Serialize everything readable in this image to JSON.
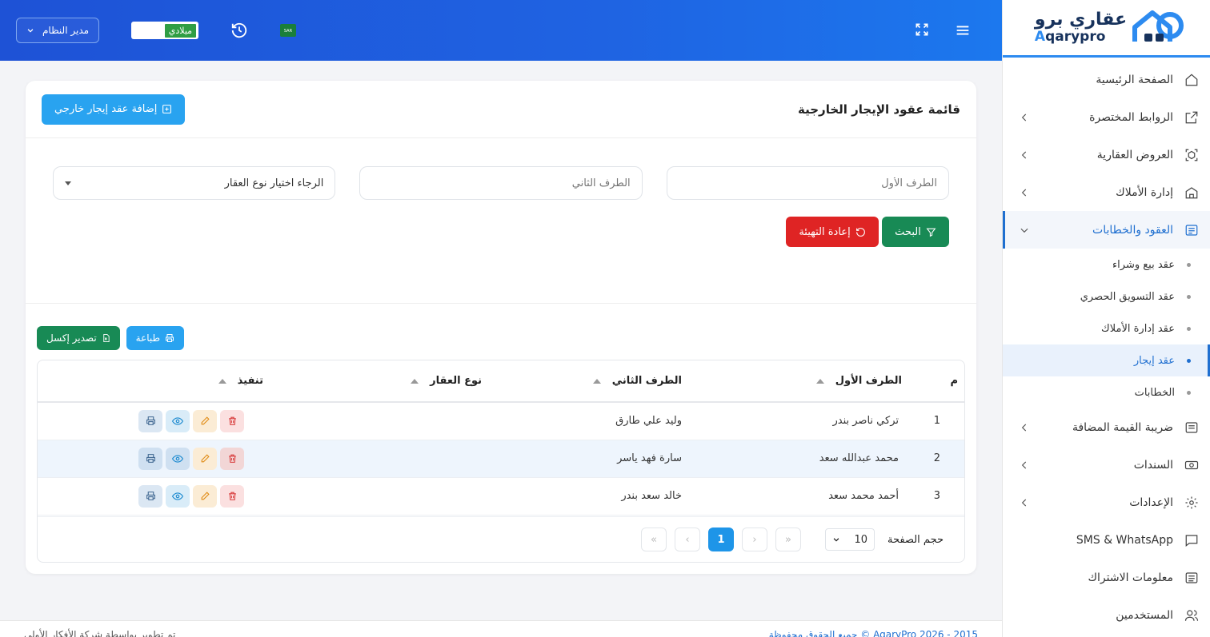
{
  "logo": {
    "ar": "عقاري برو",
    "en_a": "A",
    "en_rest": "qarypro"
  },
  "topbar": {
    "user": "مدير النظام",
    "calendar": "ميلادي",
    "flag_text": "SAR"
  },
  "sidebar": {
    "items": [
      {
        "label": "الصفحة الرئيسية"
      },
      {
        "label": "الروابط المختصرة"
      },
      {
        "label": "العروض العقارية"
      },
      {
        "label": "إدارة الأملاك"
      },
      {
        "label": "العقود والخطابات"
      },
      {
        "label": "ضريبة القيمة المضافة"
      },
      {
        "label": "السندات"
      },
      {
        "label": "الإعدادات"
      },
      {
        "label": "SMS & WhatsApp"
      },
      {
        "label": "معلومات الاشتراك"
      },
      {
        "label": "المستخدمين"
      }
    ],
    "sub_items": [
      {
        "label": "عقد بيع وشراء"
      },
      {
        "label": "عقد التسويق الحصري"
      },
      {
        "label": "عقد إدارة الأملاك"
      },
      {
        "label": "عقد إيجار"
      },
      {
        "label": "الخطابات"
      }
    ]
  },
  "page": {
    "title": "قائمة عقود الإيجار الخارجية",
    "add_label": "إضافة عقد إيجار خارجي"
  },
  "filters": {
    "first_party_placeholder": "الطرف الأول",
    "second_party_placeholder": "الطرف الثاني",
    "property_type": "الرجاء اختيار نوع العقار",
    "search_label": "البحث",
    "reset_label": "إعادة التهيئة"
  },
  "tools": {
    "excel_label": "تصدير إكسل",
    "print_label": "طباعة"
  },
  "table": {
    "headers": {
      "num": "م",
      "first": "الطرف الأول",
      "second": "الطرف الثاني",
      "type": "نوع العقار",
      "actions": "تنفيذ"
    },
    "rows": [
      {
        "num": "1",
        "first": "تركي ناصر بندر",
        "second": "وليد علي طارق",
        "type": ""
      },
      {
        "num": "2",
        "first": "محمد عبدالله سعد",
        "second": "سارة فهد ياسر",
        "type": ""
      },
      {
        "num": "3",
        "first": "أحمد محمد سعد",
        "second": "خالد سعد بندر",
        "type": ""
      }
    ]
  },
  "pager": {
    "label": "حجم الصفحة",
    "size": "10",
    "current": "1",
    "first": "«",
    "prev": "‹",
    "next": "›",
    "last": "»"
  },
  "footer": {
    "left": "AqaryPro 2026 - 2015 © جميع الحقوق محفوظة",
    "right": "تم تطوير بواسطة شركة الأفكار الأولى"
  }
}
